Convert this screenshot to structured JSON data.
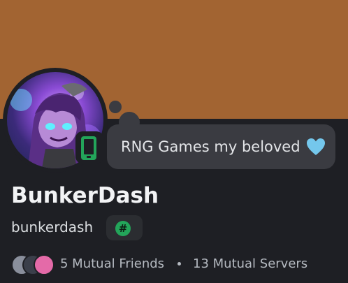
{
  "profile": {
    "display_name": "BunkerDash",
    "username": "bunkerdash",
    "status_text": "RNG Games my beloved",
    "status_emoji": "light-blue-heart-icon",
    "device_status": "mobile-online-icon",
    "badge": "#",
    "banner_color": "#a26432",
    "online_color": "#23a55a"
  },
  "mutuals": {
    "friends_label": "5 Mutual Friends",
    "servers_label": "13 Mutual Servers",
    "separator": "•"
  }
}
